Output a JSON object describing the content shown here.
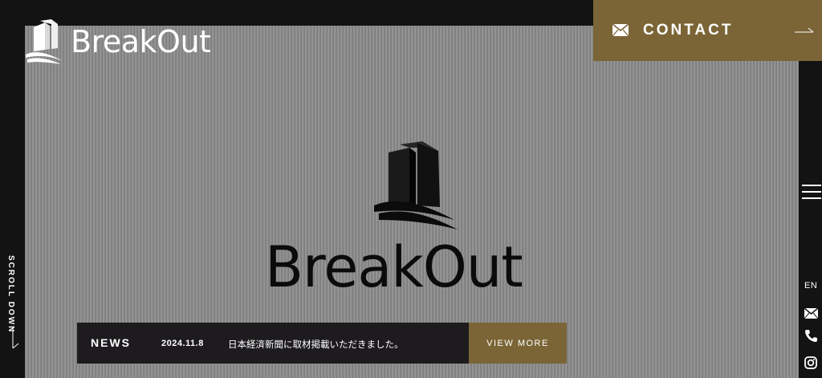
{
  "brand": {
    "name": "BreakOut"
  },
  "header": {
    "contact_label": "CONTACT",
    "contact_icon": "mail-icon",
    "arrow_icon": "arrow-right-icon",
    "menu_icon": "hamburger-menu-icon"
  },
  "side_utility": {
    "language": "EN",
    "icons": [
      "mail-icon",
      "phone-icon",
      "instagram-icon"
    ]
  },
  "hero": {
    "wordmark": "BreakOut",
    "scroll_label": "SCROLL DOWN"
  },
  "news": {
    "label": "NEWS",
    "date": "2024.11.8",
    "headline": "日本経済新聞に取材掲載いただきました。",
    "view_more": "VIEW MORE"
  },
  "colors": {
    "accent_gold": "#7b6536",
    "frame_dark": "#131313",
    "news_bg": "#1d1b1e",
    "hero_gray": "#8c8c8c"
  }
}
